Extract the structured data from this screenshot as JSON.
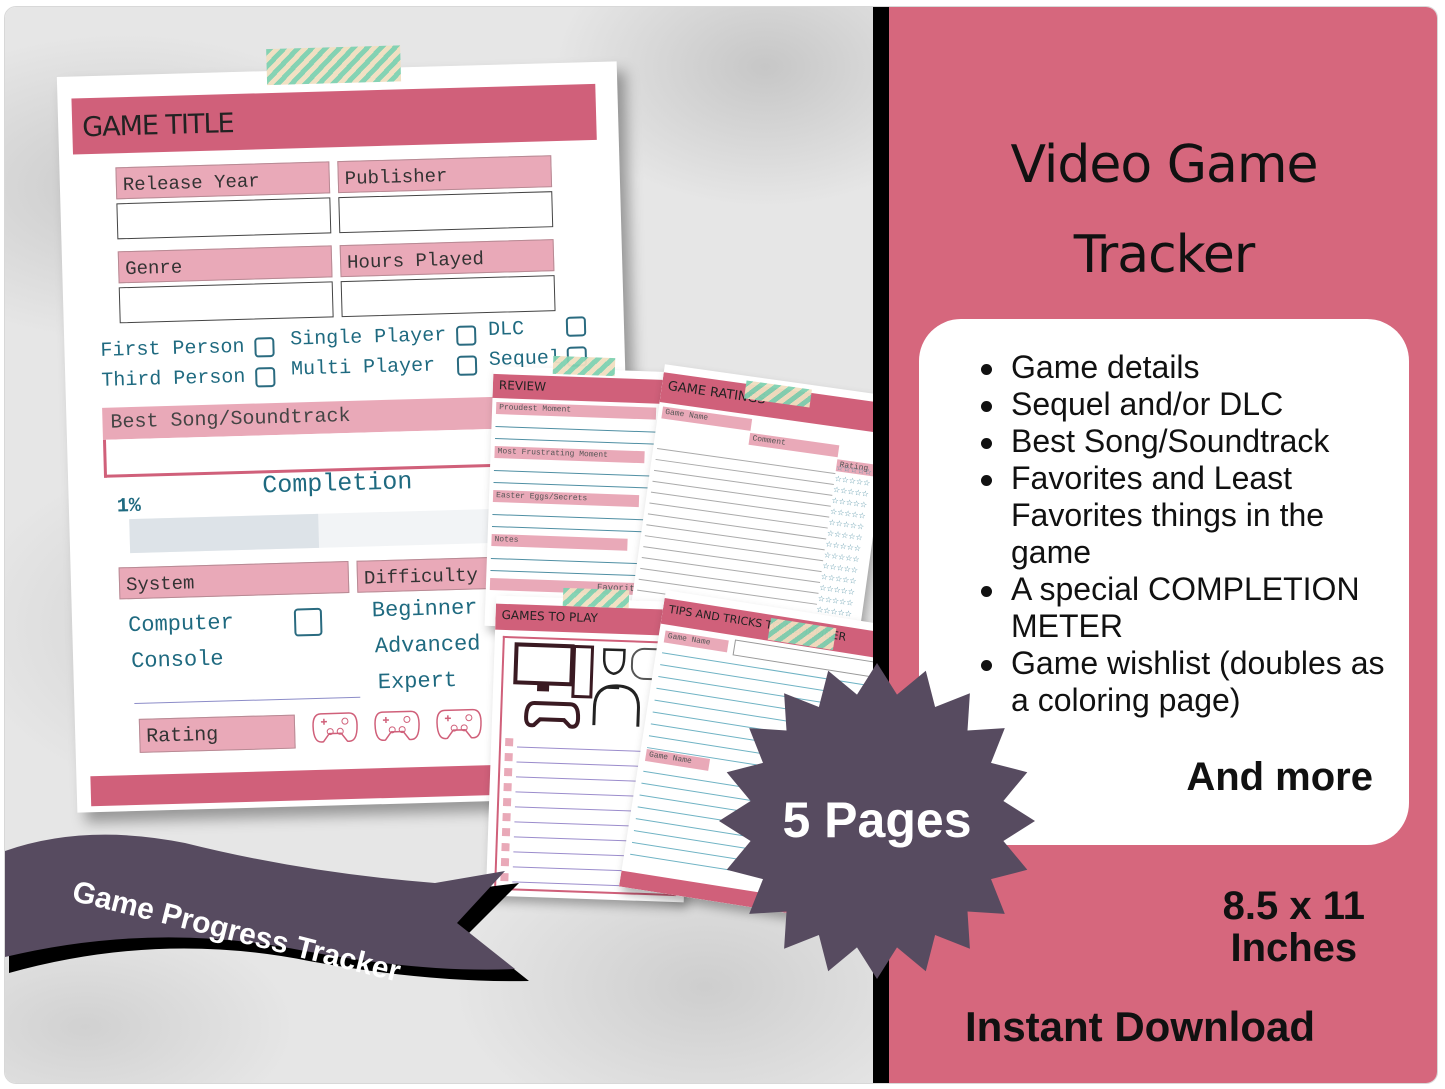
{
  "main_sheet": {
    "title": "GAME TITLE",
    "fields": [
      {
        "label": "Release Year",
        "value": ""
      },
      {
        "label": "Publisher",
        "value": ""
      },
      {
        "label": "Genre",
        "value": ""
      },
      {
        "label": "Hours Played",
        "value": ""
      }
    ],
    "options": [
      {
        "label": "First Person",
        "checked": false
      },
      {
        "label": "Single Player",
        "checked": false
      },
      {
        "label": "DLC",
        "checked": false
      },
      {
        "label": "Third Person",
        "checked": false
      },
      {
        "label": "Multi Player",
        "checked": false
      },
      {
        "label": "Sequel",
        "checked": false
      }
    ],
    "best_song_label": "Best Song/Soundtrack",
    "best_song_value": "",
    "completion_label": "Completion",
    "completion_percent_text": "1%",
    "completion_fill_fraction": 0.43,
    "system_label": "System",
    "system_options": [
      "Computer",
      "Console"
    ],
    "difficulty_label": "Difficulty",
    "difficulty_options": [
      "Beginner",
      "Advanced",
      "Expert"
    ],
    "rating_label": "Rating",
    "rating_icons": "controller-icon"
  },
  "preview_pages": {
    "review": {
      "title": "REVIEW",
      "sections": [
        "Proudest Moment",
        "Most Frustrating Moment",
        "Easter Eggs/Secrets",
        "Notes"
      ],
      "footer_label": "Favorite I"
    },
    "ratings": {
      "title": "GAME RATINGS",
      "columns": [
        "Game Name",
        "Comment",
        "Rating"
      ],
      "star_glyph": "☆☆☆☆☆"
    },
    "games_to_play": {
      "title": "GAMES TO PLAY"
    },
    "tips": {
      "title": "TIPS AND TRICKS TO REMEMBER",
      "field_label": "Game Name"
    }
  },
  "ribbon": {
    "text": "Game Progress Tracker"
  },
  "badge": {
    "text": "5 Pages"
  },
  "info_panel": {
    "title_line1": "Video Game",
    "title_line2": "Tracker",
    "features": [
      "Game details",
      "Sequel and/or DLC",
      "Best Song/Soundtrack",
      "Favorites and Least Favorites things in the game",
      "A special COMPLETION METER",
      "Game wishlist (doubles as a coloring page)"
    ],
    "and_more": "And more",
    "size_line1": "8.5 x 11",
    "size_line2": "Inches",
    "download": "Instant Download"
  },
  "colors": {
    "panel_pink": "#d6677d",
    "header_pink": "#d0607a",
    "label_pink": "#e9a9b8",
    "teal_text": "#1f6a80",
    "badge_purple": "#574b60"
  }
}
